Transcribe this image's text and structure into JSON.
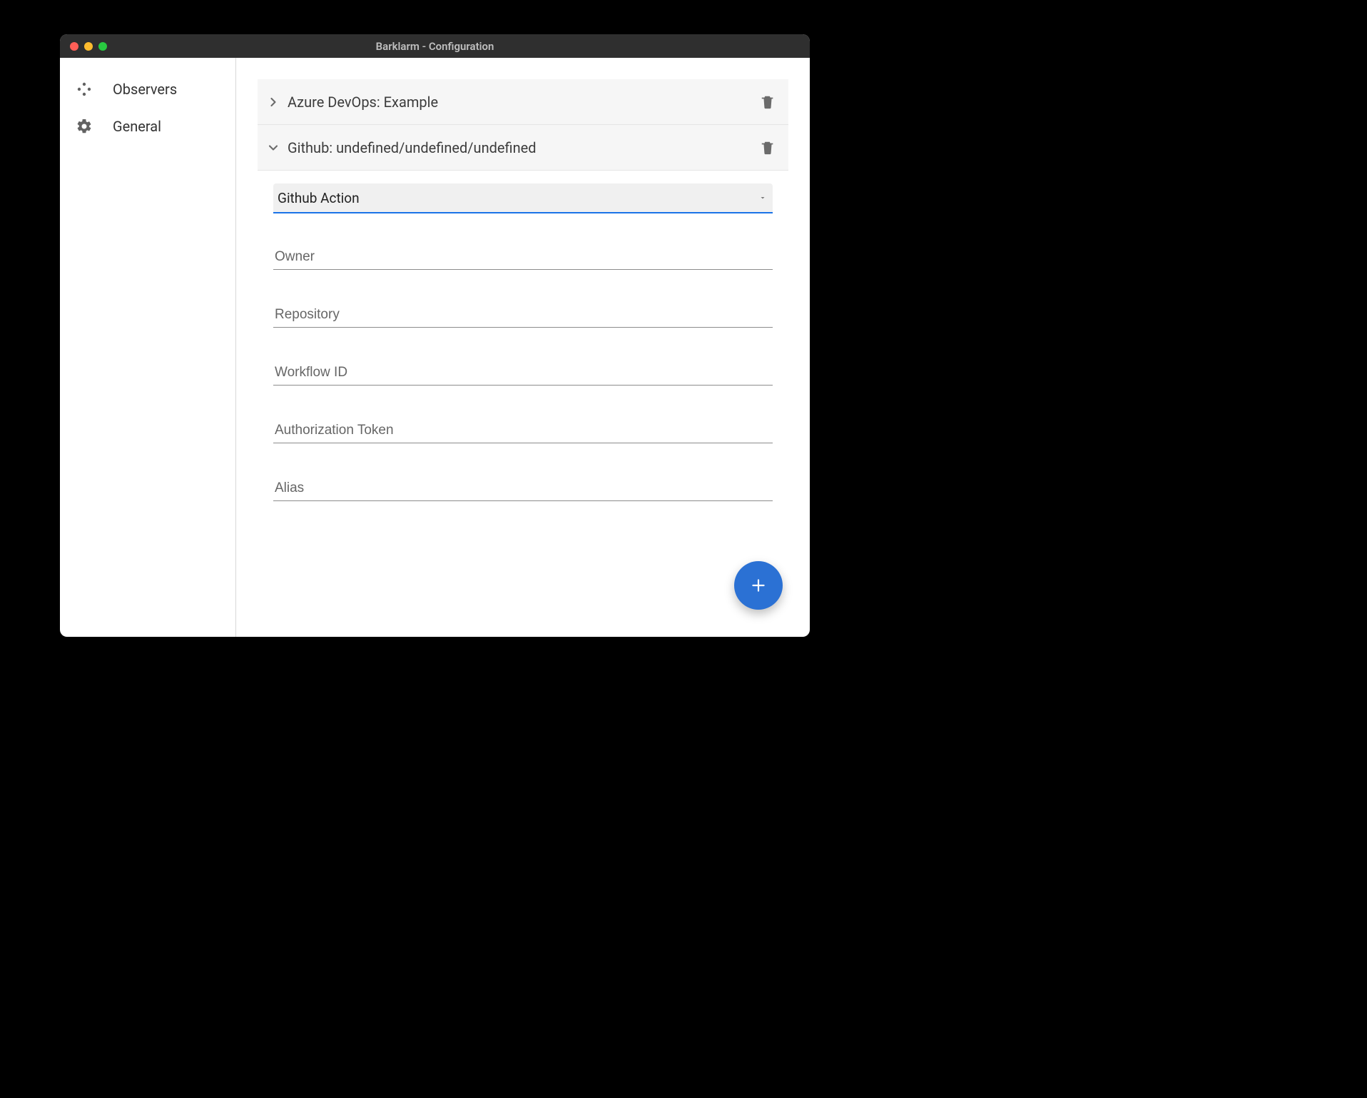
{
  "window": {
    "title": "Barklarm - Configuration"
  },
  "sidebar": {
    "items": [
      {
        "label": "Observers"
      },
      {
        "label": "General"
      }
    ]
  },
  "observers": [
    {
      "label": "Azure DevOps: Example",
      "expanded": false
    },
    {
      "label": "Github: undefined/undefined/undefined",
      "expanded": true
    }
  ],
  "form": {
    "type_select": "Github Action",
    "fields": {
      "owner": {
        "placeholder": "Owner",
        "value": ""
      },
      "repository": {
        "placeholder": "Repository",
        "value": ""
      },
      "workflow_id": {
        "placeholder": "Workflow ID",
        "value": ""
      },
      "auth_token": {
        "placeholder": "Authorization Token",
        "value": ""
      },
      "alias": {
        "placeholder": "Alias",
        "value": ""
      }
    }
  }
}
